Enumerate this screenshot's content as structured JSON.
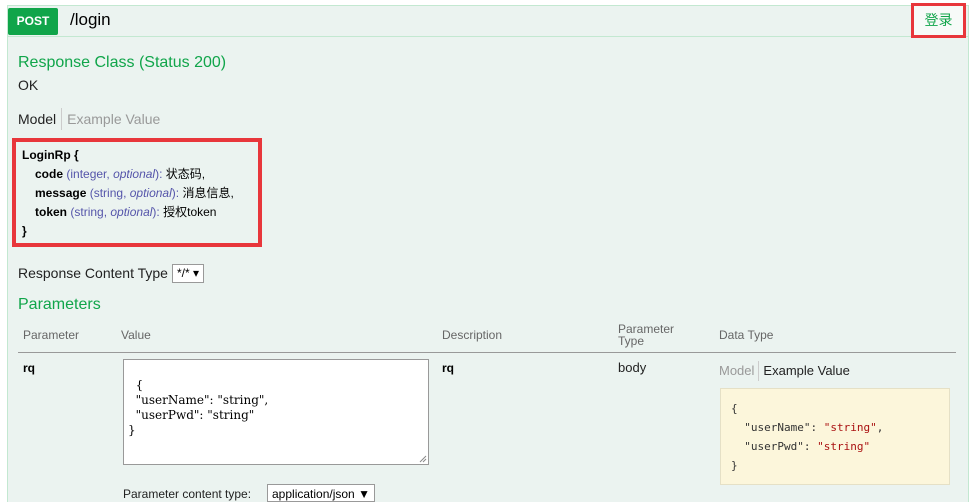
{
  "operation": {
    "method": "POST",
    "path": "/login",
    "summary": "登录"
  },
  "response": {
    "class_title": "Response Class (Status 200)",
    "status_text": "OK",
    "tabs": [
      "Model",
      "Example Value"
    ]
  },
  "model": {
    "name": "LoginRp {",
    "close": "}",
    "properties": [
      {
        "name": "code",
        "type": "integer",
        "optional": "optional",
        "description": "状态码,"
      },
      {
        "name": "message",
        "type": "string",
        "optional": "optional",
        "description": "消息信息,"
      },
      {
        "name": "token",
        "type": "string",
        "optional": "optional",
        "description": "授权token"
      }
    ]
  },
  "response_content_type": {
    "label": "Response Content Type",
    "value": "*/*"
  },
  "parameters": {
    "title": "Parameters",
    "headers": {
      "parameter": "Parameter",
      "value": "Value",
      "description": "Description",
      "parameter_type_1": "Parameter",
      "parameter_type_2": "Type",
      "data_type": "Data Type"
    },
    "row": {
      "name": "rq",
      "value": "{\n  \"userName\": \"string\",\n  \"userPwd\": \"string\"\n}",
      "description": "rq",
      "param_type": "body",
      "content_type_label": "Parameter content type:",
      "content_type_value": "application/json",
      "data_type_tabs": [
        "Model",
        "Example Value"
      ],
      "example": {
        "open": "{",
        "lines": [
          {
            "key": "\"userName\"",
            "value": "\"string\"",
            "sep": ","
          },
          {
            "key": "\"userPwd\"",
            "value": "\"string\"",
            "sep": ""
          }
        ],
        "close": "}"
      }
    }
  },
  "colors": {
    "accent_green": "#10a54a",
    "highlight_red": "#e8363b",
    "panel_bg": "#ebf3f0",
    "example_bg": "#fcf6db"
  }
}
